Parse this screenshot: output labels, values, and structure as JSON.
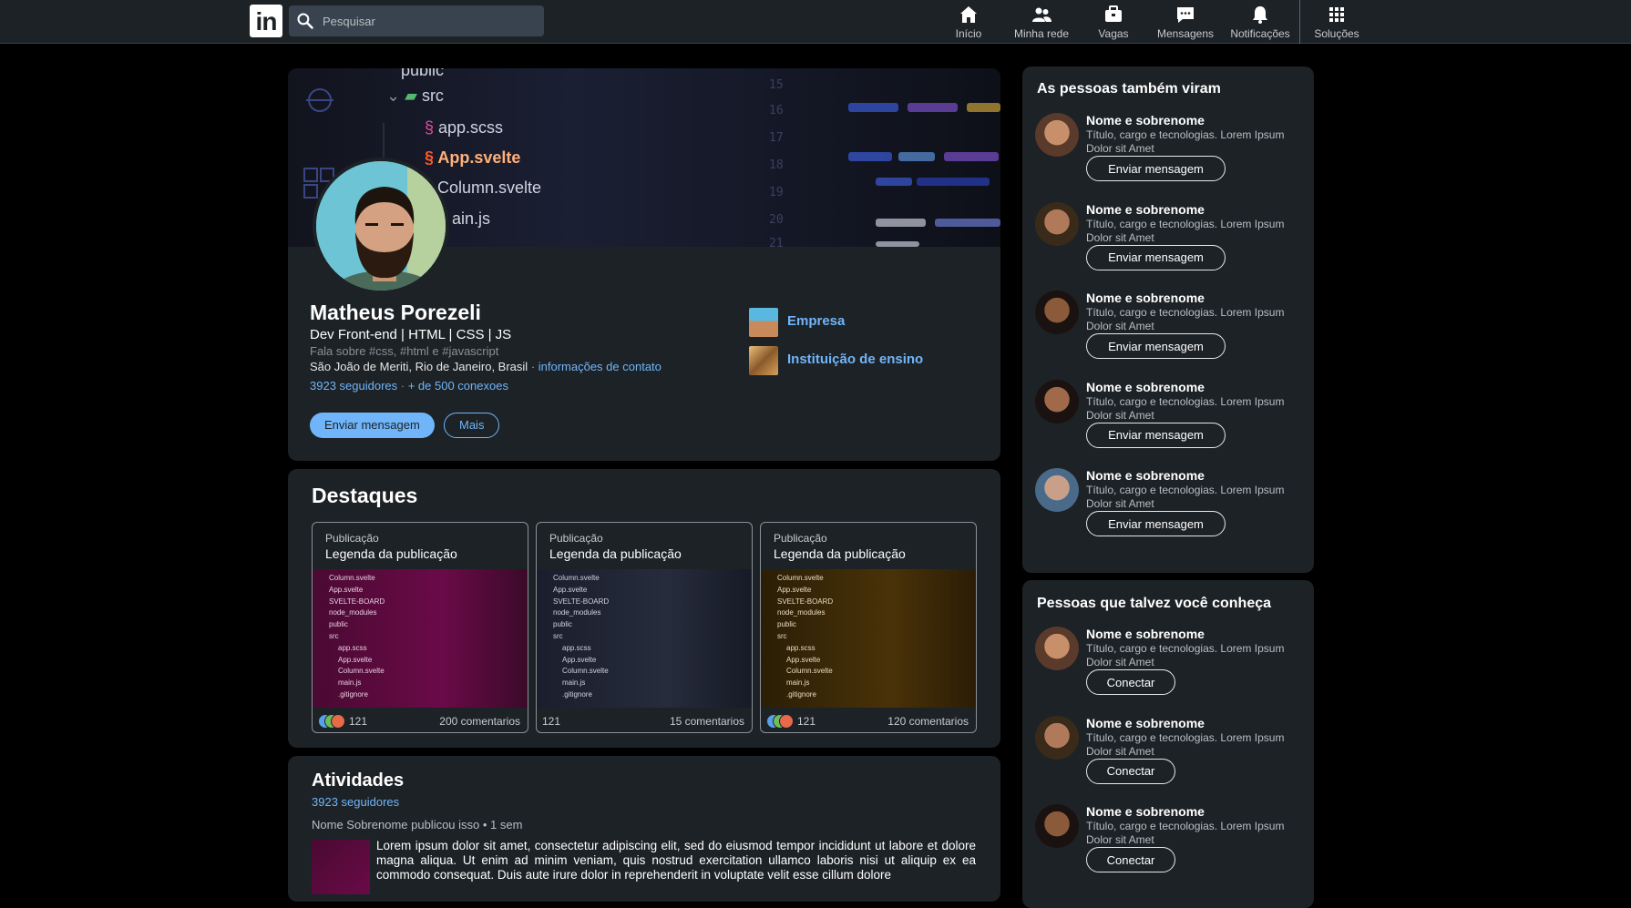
{
  "nav": {
    "search_placeholder": "Pesquisar",
    "items": [
      {
        "label": "Início",
        "icon": "home-icon"
      },
      {
        "label": "Minha rede",
        "icon": "network-icon"
      },
      {
        "label": "Vagas",
        "icon": "briefcase-icon"
      },
      {
        "label": "Mensagens",
        "icon": "message-icon"
      },
      {
        "label": "Notificações",
        "icon": "bell-icon"
      },
      {
        "label": "Soluções",
        "icon": "grid-icon"
      }
    ]
  },
  "profile": {
    "banner_files": [
      "public",
      "src",
      "app.scss",
      "App.svelte",
      "Column.svelte",
      "ain.js"
    ],
    "name": "Matheus Porezeli",
    "headline": "Dev Front-end | HTML | CSS | JS",
    "about": "Fala sobre #css, #html e #javascript",
    "location": "São João de Meriti, Rio de Janeiro, Brasil",
    "contact_link": "· informações de contato",
    "followers": "3923 seguidores",
    "connections": "+ de 500 conexoes",
    "btn_message": "Enviar mensagem",
    "btn_more": "Mais",
    "company": "Empresa",
    "school": "Instituição de ensino"
  },
  "highlights": {
    "title": "Destaques",
    "posts": [
      {
        "type": "Publicação",
        "caption": "Legenda da publicação",
        "reactions": "121",
        "comments": "200 comentarios",
        "tint": "#5a0a3c"
      },
      {
        "type": "Publicação",
        "caption": "Legenda da publicação",
        "reactions": "121",
        "comments": "15 comentarios",
        "tint": "#1c2030"
      },
      {
        "type": "Publicação",
        "caption": "Legenda da publicação",
        "reactions": "121",
        "comments": "120 comentarios",
        "tint": "#3a2a08"
      }
    ],
    "code_lines": [
      "Column.svelte",
      "App.svelte",
      "SVELTE-BOARD",
      "node_modules",
      "public",
      "src",
      "app.scss",
      "App.svelte",
      "Column.svelte",
      "main.js",
      ".gitignore"
    ]
  },
  "activities": {
    "title": "Atividades",
    "followers": "3923 seguidores",
    "meta": "Nome Sobrenome publicou isso • 1 sem",
    "text": "Lorem ipsum dolor sit amet, consectetur adipiscing elit, sed do eiusmod tempor incididunt ut labore et dolore magna aliqua. Ut enim ad minim veniam, quis nostrud exercitation ullamco laboris nisi ut aliquip ex ea commodo consequat. Duis aute irure dolor in reprehenderit in voluptate velit esse cillum dolore"
  },
  "also_viewed": {
    "title": "As pessoas também viram",
    "people": [
      {
        "name": "Nome e sobrenome",
        "desc": "Título, cargo e tecnologias. Lorem Ipsum Dolor sit Amet",
        "action": "Enviar mensagem"
      },
      {
        "name": "Nome e sobrenome",
        "desc": "Título, cargo e tecnologias. Lorem Ipsum Dolor sit Amet",
        "action": "Enviar mensagem"
      },
      {
        "name": "Nome e sobrenome",
        "desc": "Título, cargo e tecnologias. Lorem Ipsum Dolor sit Amet",
        "action": "Enviar mensagem"
      },
      {
        "name": "Nome e sobrenome",
        "desc": "Título, cargo e tecnologias. Lorem Ipsum Dolor sit Amet",
        "action": "Enviar mensagem"
      },
      {
        "name": "Nome e sobrenome",
        "desc": "Título, cargo e tecnologias. Lorem Ipsum Dolor sit Amet",
        "action": "Enviar mensagem"
      }
    ]
  },
  "may_know": {
    "title": "Pessoas que talvez você conheça",
    "people": [
      {
        "name": "Nome e sobrenome",
        "desc": "Título, cargo e tecnologias. Lorem Ipsum Dolor sit Amet",
        "action": "Conectar"
      },
      {
        "name": "Nome e sobrenome",
        "desc": "Título, cargo e tecnologias. Lorem Ipsum Dolor sit Amet",
        "action": "Conectar"
      },
      {
        "name": "Nome e sobrenome",
        "desc": "Título, cargo e tecnologias. Lorem Ipsum Dolor sit Amet",
        "action": "Conectar"
      }
    ]
  },
  "colors": {
    "accent": "#70b5f9",
    "card": "#1d2226",
    "background": "#000000"
  }
}
